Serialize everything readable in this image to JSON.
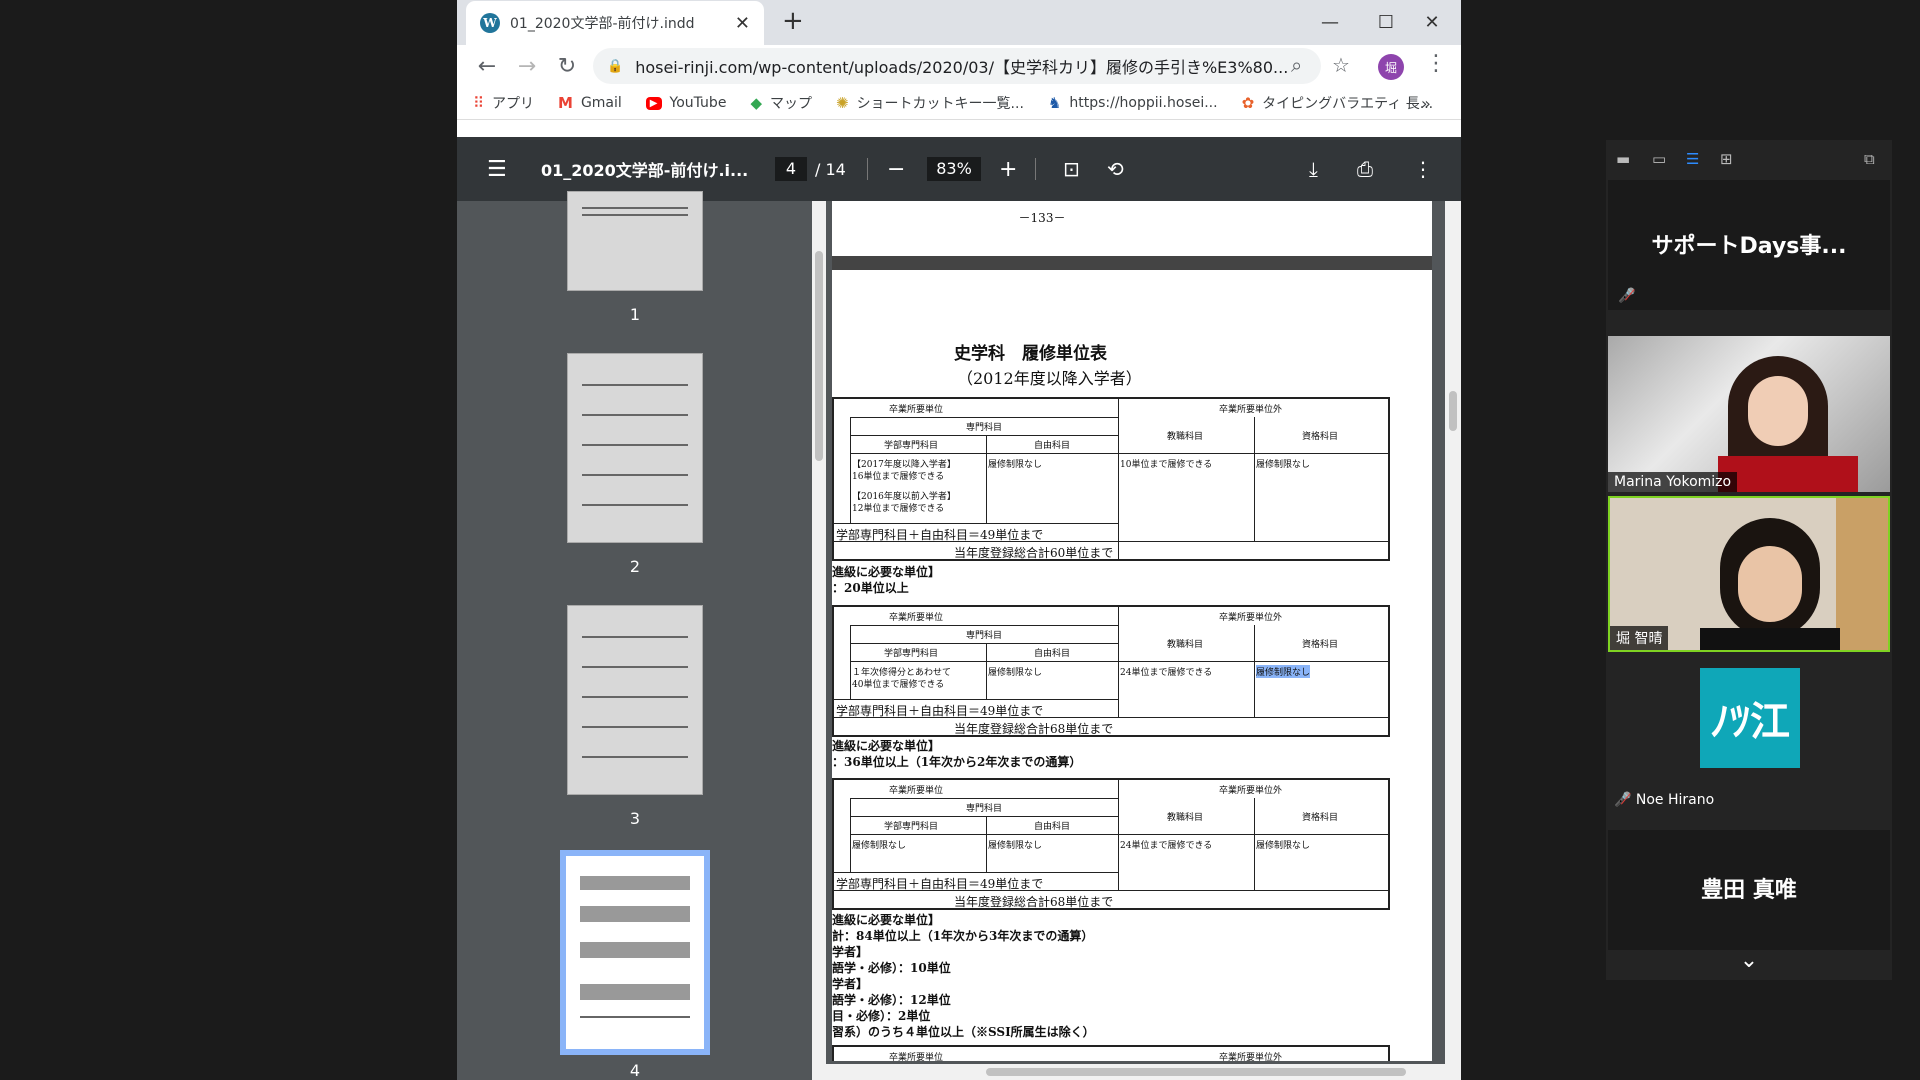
{
  "browser": {
    "tab_title": "01_2020文学部-前付け.indd",
    "tab_favicon": "W",
    "new_tab": "+",
    "win_minimize": "—",
    "win_maximize": "☐",
    "win_close": "✕",
    "url": "hosei-rinji.com/wp-content/uploads/2020/03/【史学科カリ】履修の手引き%E3%80...",
    "avatar_initial": "堀",
    "bookmarks": [
      {
        "icon": "apps-icon",
        "glyph": "⠿",
        "label": "アプリ"
      },
      {
        "icon": "gmail-icon",
        "glyph": "M",
        "label": "Gmail"
      },
      {
        "icon": "youtube-icon",
        "glyph": "▶",
        "label": "YouTube"
      },
      {
        "icon": "maps-icon",
        "glyph": "◆",
        "label": "マップ"
      },
      {
        "icon": "shortcut-icon",
        "glyph": "✺",
        "label": "ショートカットキー一覧..."
      },
      {
        "icon": "hoppii-icon",
        "glyph": "♞",
        "label": "https://hoppii.hosei..."
      },
      {
        "icon": "typing-icon",
        "glyph": "✿",
        "label": "タイピングバラエティ 長..."
      }
    ],
    "bookmarks_more": "»"
  },
  "pdf": {
    "doc_title": "01_2020文学部-前付け.i...",
    "current_page": "4",
    "total_pages": "/ 14",
    "zoom": "83%",
    "zoom_minus": "−",
    "zoom_plus": "+",
    "thumbnails": [
      "1",
      "2",
      "3",
      "4"
    ],
    "page_number": "－133－",
    "title": "史学科　履修単位表",
    "subtitle": "（2012年度以降入学者）",
    "h_sotsu": "卒業所要単位",
    "h_sotsugai": "卒業所要単位外",
    "h_senmon": "専門科目",
    "h_gakubu": "学部専門科目",
    "h_jiyu": "自由科目",
    "h_kyoshoku": "教職科目",
    "h_shikaku": "資格科目",
    "t1_gakubu_a1": "【2017年度以降入学者】",
    "t1_gakubu_a2": "16単位まで履修できる",
    "t1_gakubu_b1": "【2016年度以前入学者】",
    "t1_gakubu_b2": "12単位まで履修できる",
    "t1_jiyu": "履修制限なし",
    "t1_kyoshoku": "10単位まで履修できる",
    "t1_shikaku": "履修制限なし",
    "sum_line": "学部専門科目＋自由科目＝49単位まで",
    "t1_total": "当年度登録総合計60単位まで",
    "t1_req1": "進級に必要な単位】",
    "t1_req2": "：20単位以上",
    "t2_gakubu1": "１年次修得分とあわせて",
    "t2_gakubu2": "40単位まで履修できる",
    "t2_jiyu": "履修制限なし",
    "t2_kyoshoku": "24単位まで履修できる",
    "t2_shikaku": "履修制限なし",
    "t2_total": "当年度登録総合計68単位まで",
    "t2_req1": "進級に必要な単位】",
    "t2_req2": "：36単位以上（1年次から2年次までの通算）",
    "t3_gakubu": "履修制限なし",
    "t3_jiyu": "履修制限なし",
    "t3_kyoshoku": "24単位まで履修できる",
    "t3_shikaku": "履修制限なし",
    "t3_total": "当年度登録総合計68単位まで",
    "t3_req1": "進級に必要な単位】",
    "t3_req2": "計：84単位以上（1年次から3年次までの通算）",
    "t3_req3": "学者】",
    "t3_req4": "語学・必修）：10単位",
    "t3_req5": "学者】",
    "t3_req6": "語学・必修）：12単位",
    "t3_req7": "目・必修）：2単位",
    "t3_req8": "習系）のうち４単位以上（※SSI所属生は除く）"
  },
  "zoom": {
    "screen_share_title": "サポートDays事...",
    "participants": [
      {
        "name": "Marina Yokomizo"
      },
      {
        "name": "堀 智晴"
      },
      {
        "name": "Noe Hirano"
      },
      {
        "name": "豊田 真唯"
      }
    ],
    "noe_logo": "ﾉﾂ江",
    "chevron": "⌄"
  },
  "colors": {
    "accent": "#8ab4f8",
    "pdf_toolbar": "#323639",
    "logo_teal": "#0fa7b8"
  }
}
